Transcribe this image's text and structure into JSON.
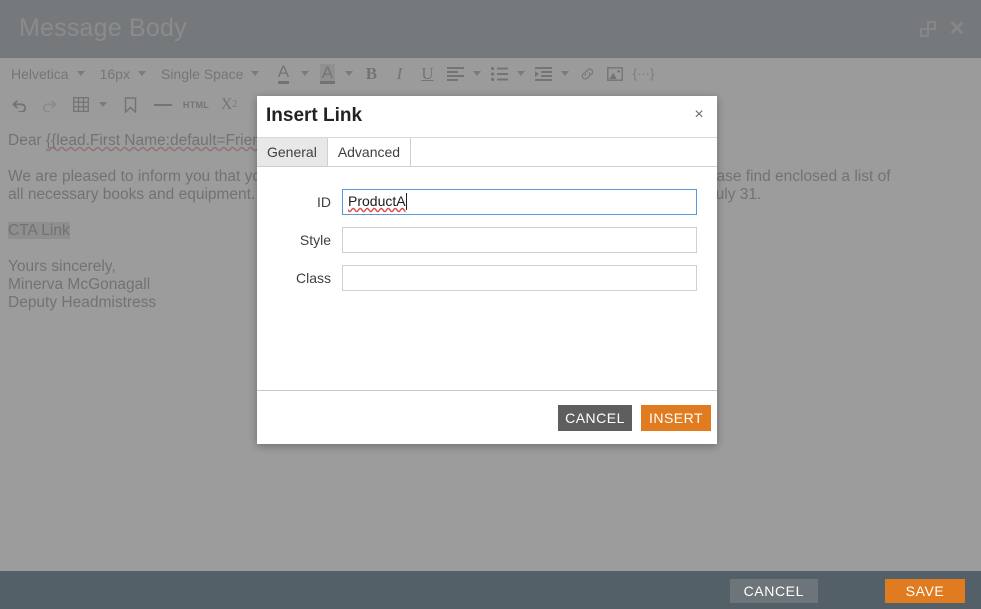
{
  "window": {
    "title": "Message Body",
    "restore_icon": "restore-window-icon",
    "close_icon": "close-window-icon",
    "close_glyph": "✕"
  },
  "toolbar": {
    "row1": {
      "font_family": "Helvetica",
      "font_size": "16px",
      "line_spacing": "Single Space",
      "text_color_icon": "text-color-icon",
      "highlight_color_icon": "highlight-color-icon",
      "bold_label": "B",
      "italic_label": "I",
      "underline_label": "U",
      "align_icon": "align-left-icon",
      "list_icon": "bullet-list-icon",
      "indent_icon": "indent-icon",
      "link_icon": "insert-link-icon",
      "image_icon": "insert-image-icon",
      "token_label": "{···}"
    },
    "row2": {
      "undo_icon": "undo-icon",
      "redo_icon": "redo-icon",
      "table_icon": "insert-table-icon",
      "bookmark_icon": "bookmark-icon",
      "hr_icon": "horizontal-rule-icon",
      "html_label": "HTML",
      "subscript_label": "X",
      "subscript_sub": "2"
    }
  },
  "message": {
    "greeting_prefix": "Dear ",
    "greeting_token": "{{lead.First Name:default=Friend}}",
    "paragraph_line1": "We are pleased to inform you that you have a place at Hogwarts School of Witchcraft and Wizardry. Please find enclosed a list of",
    "paragraph_line2": "all necessary books and equipment. Term begins on September 1. We await your owl by no later than July 31.",
    "cta_text": "CTA Link",
    "signoff_line1": "Yours sincerely,",
    "signoff_line2": "Minerva McGonagall",
    "signoff_line3": "Deputy Headmistress"
  },
  "footer": {
    "cancel_label": "CANCEL",
    "save_label": "SAVE"
  },
  "dialog": {
    "title": "Insert Link",
    "close_glyph": "×",
    "tabs": [
      {
        "label": "General",
        "active": true
      },
      {
        "label": "Advanced",
        "active": false
      }
    ],
    "fields": [
      {
        "label": "ID",
        "value": "ProductA",
        "placeholder": "",
        "focused": true
      },
      {
        "label": "Style",
        "value": "",
        "placeholder": "",
        "focused": false
      },
      {
        "label": "Class",
        "value": "",
        "placeholder": "",
        "focused": false
      }
    ],
    "cancel_label": "CANCEL",
    "insert_label": "INSERT"
  },
  "colors": {
    "chrome": "#546068",
    "accent_orange": "#e07b20",
    "overlay": "#808080",
    "focus_blue": "#5b9bd5",
    "spellcheck_red": "#d64b4b"
  }
}
